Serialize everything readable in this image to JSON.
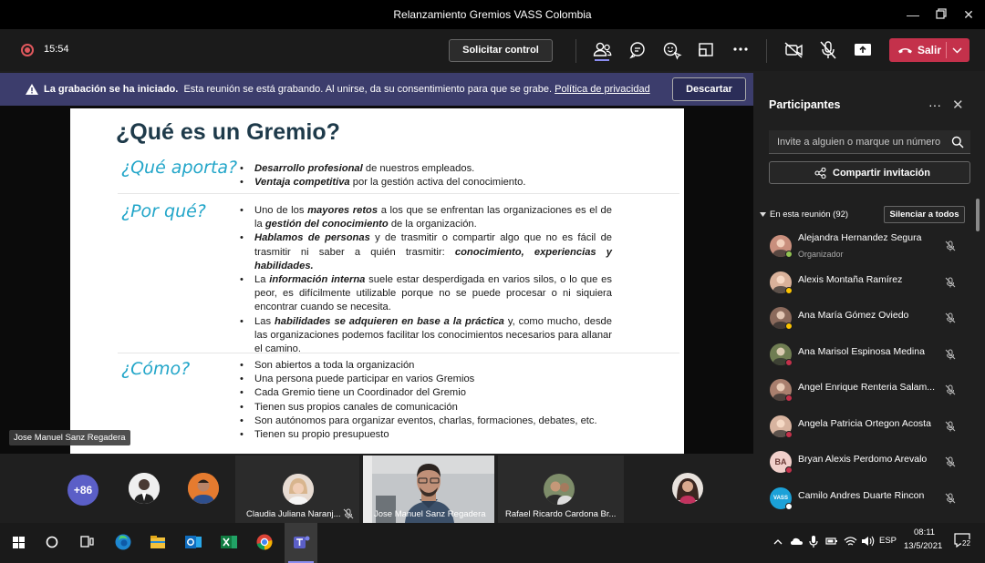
{
  "window": {
    "title": "Relanzamiento Gremios VASS Colombia"
  },
  "toolbar": {
    "timer": "15:54",
    "request_control_label": "Solicitar control",
    "leave_label": "Salir"
  },
  "banner": {
    "bold_text": "La grabación se ha iniciado.",
    "text": "Esta reunión se está grabando. Al unirse, da su consentimiento para que se grabe.",
    "link_text": "Política de privacidad",
    "dismiss_label": "Descartar"
  },
  "slide": {
    "title": "¿Qué es un Gremio?",
    "sections": [
      {
        "heading": "¿Qué aporta?",
        "bullets": [
          "<b><i>Desarrollo profesional</i></b> de nuestros empleados.",
          "<b><i>Ventaja competitiva</i></b> por la gestión activa del conocimiento."
        ]
      },
      {
        "heading": "¿Por qué?",
        "bullets": [
          "Uno de los <b><i>mayores retos</i></b> a los que se enfrentan las organizaciones es el de la <b><i>gestión del conocimiento</i></b> de la organización.",
          "<b><i>Hablamos de personas</i></b> y de trasmitir o compartir algo que no es fácil de trasmitir ni saber a quién trasmitir: <b><i>conocimiento, experiencias y habilidades.</i></b>",
          "La <b><i>información interna</i></b> suele estar desperdigada en varios silos, o lo que es peor, es difícilmente utilizable porque no se puede procesar o ni siquiera encontrar cuando se necesita.",
          "Las <b><i>habilidades se adquieren en base a la práctica</i></b> y, como mucho, desde las organizaciones podemos facilitar los conocimientos necesarios para allanar el camino."
        ]
      },
      {
        "heading": "¿Cómo?",
        "bullets": [
          "Son abiertos a toda la organización",
          "Una persona puede participar en varios Gremios",
          "Cada Gremio tiene un Coordinador del Gremio",
          "Tienen sus propios canales de comunicación",
          "Son autónomos para organizar eventos, charlas, formaciones, debates, etc.",
          "Tienen su propio presupuesto"
        ]
      }
    ]
  },
  "presenter_tag": "Jose Manuel Sanz Regadera",
  "gallery": {
    "more_count": "+86",
    "tiles": [
      {
        "name": "Claudia Juliana Naranj..."
      },
      {
        "name": "Jose Manuel Sanz Regadera"
      },
      {
        "name": "Rafael Ricardo Cardona Br..."
      }
    ]
  },
  "panel": {
    "title": "Participantes",
    "invite_placeholder": "Invite a alguien o marque un número",
    "share_label": "Compartir invitación",
    "section_label": "En esta reunión (92)",
    "mute_all_label": "Silenciar a todos",
    "participants": [
      {
        "name": "Alejandra Hernandez Segura",
        "role": "Organizador",
        "avatar_color": "#c98f7d",
        "status": "#92c353"
      },
      {
        "name": "Alexis Montaña Ramírez",
        "role": "",
        "avatar_color": "#d9b19a",
        "status": "#fcc300"
      },
      {
        "name": "Ana María Gómez Oviedo",
        "role": "",
        "avatar_color": "#8b6a5c",
        "status": "#fcc300"
      },
      {
        "name": "Ana Marisol Espinosa Medina",
        "role": "",
        "avatar_color": "#6f7d52",
        "status": "#c4314b"
      },
      {
        "name": "Angel Enrique Renteria Salam...",
        "role": "",
        "avatar_color": "#a97f6e",
        "status": "#c4314b"
      },
      {
        "name": "Angela Patricia Ortegon Acosta",
        "role": "",
        "avatar_color": "#d8b4a0",
        "status": "#c4314b"
      },
      {
        "name": "Bryan Alexis Perdomo Arevalo",
        "role": "",
        "avatar_initials": "BA",
        "avatar_color": "#f1d0cb",
        "status": "#c4314b"
      },
      {
        "name": "Camilo Andres Duarte Rincon",
        "role": "",
        "avatar_initials": "VASS",
        "avatar_color": "#1ba1d8",
        "status": "#ffffff"
      }
    ]
  },
  "taskbar": {
    "time": "08:11",
    "date": "13/5/2021",
    "language": "ESP",
    "notifications": "22"
  },
  "colors": {
    "accent": "#5b5fc7",
    "leave": "#c4314b",
    "banner": "#3c3d6c",
    "slide_heading": "#23a6c9",
    "slide_title": "#1e3a4a"
  }
}
